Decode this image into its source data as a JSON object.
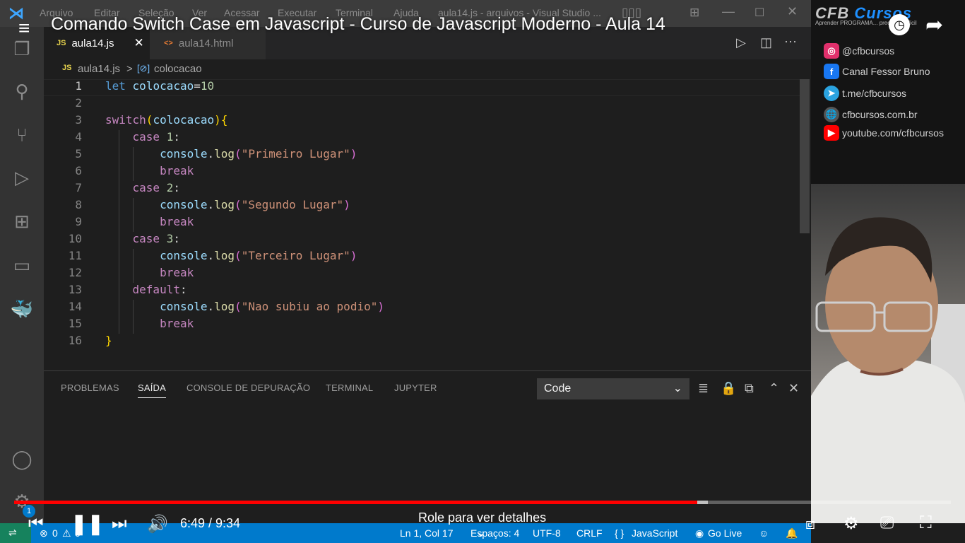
{
  "video": {
    "title": "Comando Switch Case em Javascript - Curso de Javascript Moderno - Aula 14",
    "time_current": "6:49",
    "time_total": "9:34",
    "time_display": "6:49 / 9:34",
    "progress": 0.7293,
    "buffered": 0.7406,
    "scroll_hint": "Role para ver detalhes"
  },
  "vscode": {
    "menu": [
      "Arquivo",
      "Editar",
      "Seleção",
      "Ver",
      "Acessar",
      "Executar",
      "Terminal",
      "Ajuda"
    ],
    "window_title": "aula14.js - arquivos - Visual Studio ...",
    "tabs": [
      {
        "icon": "JS",
        "label": "aula14.js",
        "active": true
      },
      {
        "icon": "<>",
        "label": "aula14.html",
        "active": false
      }
    ],
    "breadcrumb": {
      "file_icon": "JS",
      "file": "aula14.js",
      "separator": ">",
      "symbol": "colocacao"
    },
    "code_lines": [
      {
        "n": "1",
        "text": "let colocacao=10"
      },
      {
        "n": "2",
        "text": ""
      },
      {
        "n": "3",
        "text": "switch(colocacao){"
      },
      {
        "n": "4",
        "text": "    case 1:"
      },
      {
        "n": "5",
        "text": "        console.log(\"Primeiro Lugar\")"
      },
      {
        "n": "6",
        "text": "        break"
      },
      {
        "n": "7",
        "text": "    case 2:"
      },
      {
        "n": "8",
        "text": "        console.log(\"Segundo Lugar\")"
      },
      {
        "n": "9",
        "text": "        break"
      },
      {
        "n": "10",
        "text": "    case 3:"
      },
      {
        "n": "11",
        "text": "        console.log(\"Terceiro Lugar\")"
      },
      {
        "n": "12",
        "text": "        break"
      },
      {
        "n": "13",
        "text": "    default:"
      },
      {
        "n": "14",
        "text": "        console.log(\"Nao subiu ao podio\")"
      },
      {
        "n": "15",
        "text": "        break"
      },
      {
        "n": "16",
        "text": "}"
      }
    ],
    "panel": {
      "tabs": [
        "PROBLEMAS",
        "SAÍDA",
        "CONSOLE DE DEPURAÇÃO",
        "TERMINAL",
        "JUPYTER"
      ],
      "active_tab": "SAÍDA",
      "output_select": "Code"
    },
    "status": {
      "errors": "0",
      "warnings": "0",
      "position": "Ln 1, Col 17",
      "spaces": "Espaços: 4",
      "encoding": "UTF-8",
      "eol": "CRLF",
      "language": "JavaScript",
      "golive": "Go Live",
      "badge": "1"
    }
  },
  "channel": {
    "logo_cfb": "CFB",
    "logo_cursos": "Cursos",
    "tagline": "Aprender PROGRAMA... preciso... difícil",
    "socials": [
      {
        "icon": "instagram-icon",
        "label": "@cfbcursos",
        "color": "#e1306c"
      },
      {
        "icon": "facebook-icon",
        "label": "Canal Fessor Bruno",
        "color": "#1877f2"
      },
      {
        "icon": "telegram-icon",
        "label": "t.me/cfbcursos",
        "color": "#2aa3e0"
      },
      {
        "icon": "web-icon",
        "label": "cfbcursos.com.br",
        "color": "#888888"
      },
      {
        "icon": "youtube-icon",
        "label": "youtube.com/cfbcursos",
        "color": "#ff0000"
      }
    ]
  },
  "colors": {
    "statusbar": "#007acc",
    "progress": "#ff0000",
    "editor_bg": "#1e1e1e"
  }
}
